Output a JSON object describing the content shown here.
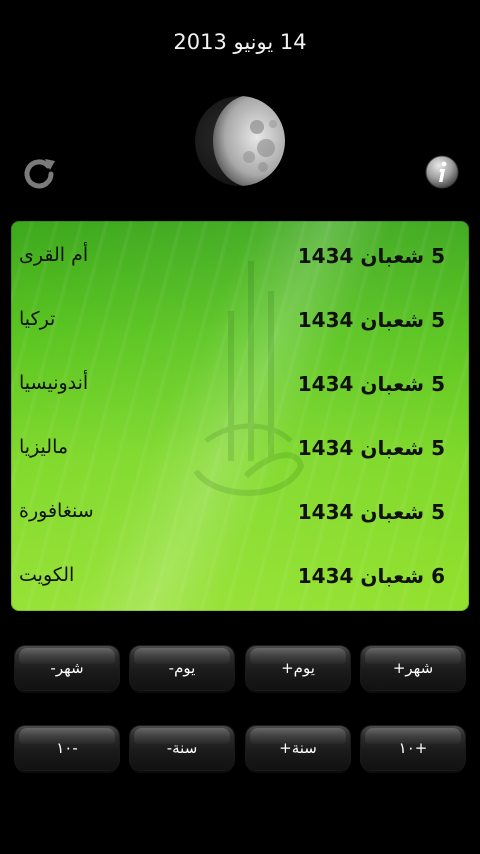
{
  "header": {
    "date": "14 يونيو 2013"
  },
  "icons": {
    "refresh": "refresh-icon",
    "info": "info-icon",
    "moon": "moon-phase-icon"
  },
  "rows": [
    {
      "country": "أم القرى",
      "hijri": "5 شعبان  1434"
    },
    {
      "country": "تركيا",
      "hijri": "5 شعبان 1434"
    },
    {
      "country": "أندونيسيا",
      "hijri": "5 شعبان 1434"
    },
    {
      "country": "ماليزيا",
      "hijri": "5 شعبان 1434"
    },
    {
      "country": "سنغافورة",
      "hijri": "5 شعبان 1434"
    },
    {
      "country": "الكويت",
      "hijri": "6 شعبان 1434"
    }
  ],
  "buttons": {
    "month_minus": "-شهر",
    "day_minus": "-يوم",
    "day_plus": "+يوم",
    "month_plus": "+شهر",
    "ten_minus": "١٠-",
    "year_minus": "-سنة",
    "year_plus": "+سنة",
    "ten_plus": "١٠+"
  }
}
